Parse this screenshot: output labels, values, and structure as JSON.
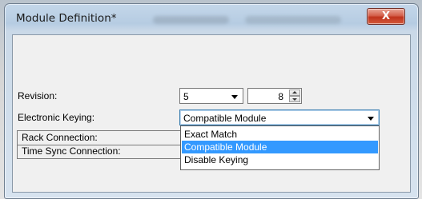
{
  "window": {
    "title": "Module Definition*",
    "close_glyph": "X"
  },
  "form": {
    "revision": {
      "label": "Revision:",
      "major": "5",
      "minor": "8"
    },
    "electronic_keying": {
      "label": "Electronic Keying:",
      "value": "Compatible Module"
    },
    "rows": [
      {
        "label": "Rack Connection:"
      },
      {
        "label": "Time Sync Connection:"
      }
    ]
  },
  "keying_dropdown": {
    "options": [
      {
        "label": "Exact Match"
      },
      {
        "label": "Compatible Module"
      },
      {
        "label": "Disable Keying"
      }
    ],
    "selected_index": 1,
    "highlight_color": "#3399ff"
  }
}
